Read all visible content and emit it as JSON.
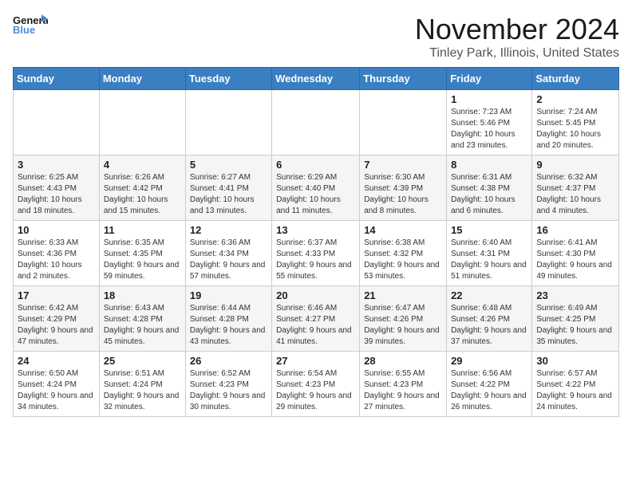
{
  "header": {
    "logo_line1": "General",
    "logo_line2": "Blue",
    "title": "November 2024",
    "subtitle": "Tinley Park, Illinois, United States"
  },
  "weekdays": [
    "Sunday",
    "Monday",
    "Tuesday",
    "Wednesday",
    "Thursday",
    "Friday",
    "Saturday"
  ],
  "weeks": [
    [
      {
        "day": "",
        "info": ""
      },
      {
        "day": "",
        "info": ""
      },
      {
        "day": "",
        "info": ""
      },
      {
        "day": "",
        "info": ""
      },
      {
        "day": "",
        "info": ""
      },
      {
        "day": "1",
        "info": "Sunrise: 7:23 AM\nSunset: 5:46 PM\nDaylight: 10 hours and 23 minutes."
      },
      {
        "day": "2",
        "info": "Sunrise: 7:24 AM\nSunset: 5:45 PM\nDaylight: 10 hours and 20 minutes."
      }
    ],
    [
      {
        "day": "3",
        "info": "Sunrise: 6:25 AM\nSunset: 4:43 PM\nDaylight: 10 hours and 18 minutes."
      },
      {
        "day": "4",
        "info": "Sunrise: 6:26 AM\nSunset: 4:42 PM\nDaylight: 10 hours and 15 minutes."
      },
      {
        "day": "5",
        "info": "Sunrise: 6:27 AM\nSunset: 4:41 PM\nDaylight: 10 hours and 13 minutes."
      },
      {
        "day": "6",
        "info": "Sunrise: 6:29 AM\nSunset: 4:40 PM\nDaylight: 10 hours and 11 minutes."
      },
      {
        "day": "7",
        "info": "Sunrise: 6:30 AM\nSunset: 4:39 PM\nDaylight: 10 hours and 8 minutes."
      },
      {
        "day": "8",
        "info": "Sunrise: 6:31 AM\nSunset: 4:38 PM\nDaylight: 10 hours and 6 minutes."
      },
      {
        "day": "9",
        "info": "Sunrise: 6:32 AM\nSunset: 4:37 PM\nDaylight: 10 hours and 4 minutes."
      }
    ],
    [
      {
        "day": "10",
        "info": "Sunrise: 6:33 AM\nSunset: 4:36 PM\nDaylight: 10 hours and 2 minutes."
      },
      {
        "day": "11",
        "info": "Sunrise: 6:35 AM\nSunset: 4:35 PM\nDaylight: 9 hours and 59 minutes."
      },
      {
        "day": "12",
        "info": "Sunrise: 6:36 AM\nSunset: 4:34 PM\nDaylight: 9 hours and 57 minutes."
      },
      {
        "day": "13",
        "info": "Sunrise: 6:37 AM\nSunset: 4:33 PM\nDaylight: 9 hours and 55 minutes."
      },
      {
        "day": "14",
        "info": "Sunrise: 6:38 AM\nSunset: 4:32 PM\nDaylight: 9 hours and 53 minutes."
      },
      {
        "day": "15",
        "info": "Sunrise: 6:40 AM\nSunset: 4:31 PM\nDaylight: 9 hours and 51 minutes."
      },
      {
        "day": "16",
        "info": "Sunrise: 6:41 AM\nSunset: 4:30 PM\nDaylight: 9 hours and 49 minutes."
      }
    ],
    [
      {
        "day": "17",
        "info": "Sunrise: 6:42 AM\nSunset: 4:29 PM\nDaylight: 9 hours and 47 minutes."
      },
      {
        "day": "18",
        "info": "Sunrise: 6:43 AM\nSunset: 4:28 PM\nDaylight: 9 hours and 45 minutes."
      },
      {
        "day": "19",
        "info": "Sunrise: 6:44 AM\nSunset: 4:28 PM\nDaylight: 9 hours and 43 minutes."
      },
      {
        "day": "20",
        "info": "Sunrise: 6:46 AM\nSunset: 4:27 PM\nDaylight: 9 hours and 41 minutes."
      },
      {
        "day": "21",
        "info": "Sunrise: 6:47 AM\nSunset: 4:26 PM\nDaylight: 9 hours and 39 minutes."
      },
      {
        "day": "22",
        "info": "Sunrise: 6:48 AM\nSunset: 4:26 PM\nDaylight: 9 hours and 37 minutes."
      },
      {
        "day": "23",
        "info": "Sunrise: 6:49 AM\nSunset: 4:25 PM\nDaylight: 9 hours and 35 minutes."
      }
    ],
    [
      {
        "day": "24",
        "info": "Sunrise: 6:50 AM\nSunset: 4:24 PM\nDaylight: 9 hours and 34 minutes."
      },
      {
        "day": "25",
        "info": "Sunrise: 6:51 AM\nSunset: 4:24 PM\nDaylight: 9 hours and 32 minutes."
      },
      {
        "day": "26",
        "info": "Sunrise: 6:52 AM\nSunset: 4:23 PM\nDaylight: 9 hours and 30 minutes."
      },
      {
        "day": "27",
        "info": "Sunrise: 6:54 AM\nSunset: 4:23 PM\nDaylight: 9 hours and 29 minutes."
      },
      {
        "day": "28",
        "info": "Sunrise: 6:55 AM\nSunset: 4:23 PM\nDaylight: 9 hours and 27 minutes."
      },
      {
        "day": "29",
        "info": "Sunrise: 6:56 AM\nSunset: 4:22 PM\nDaylight: 9 hours and 26 minutes."
      },
      {
        "day": "30",
        "info": "Sunrise: 6:57 AM\nSunset: 4:22 PM\nDaylight: 9 hours and 24 minutes."
      }
    ]
  ]
}
